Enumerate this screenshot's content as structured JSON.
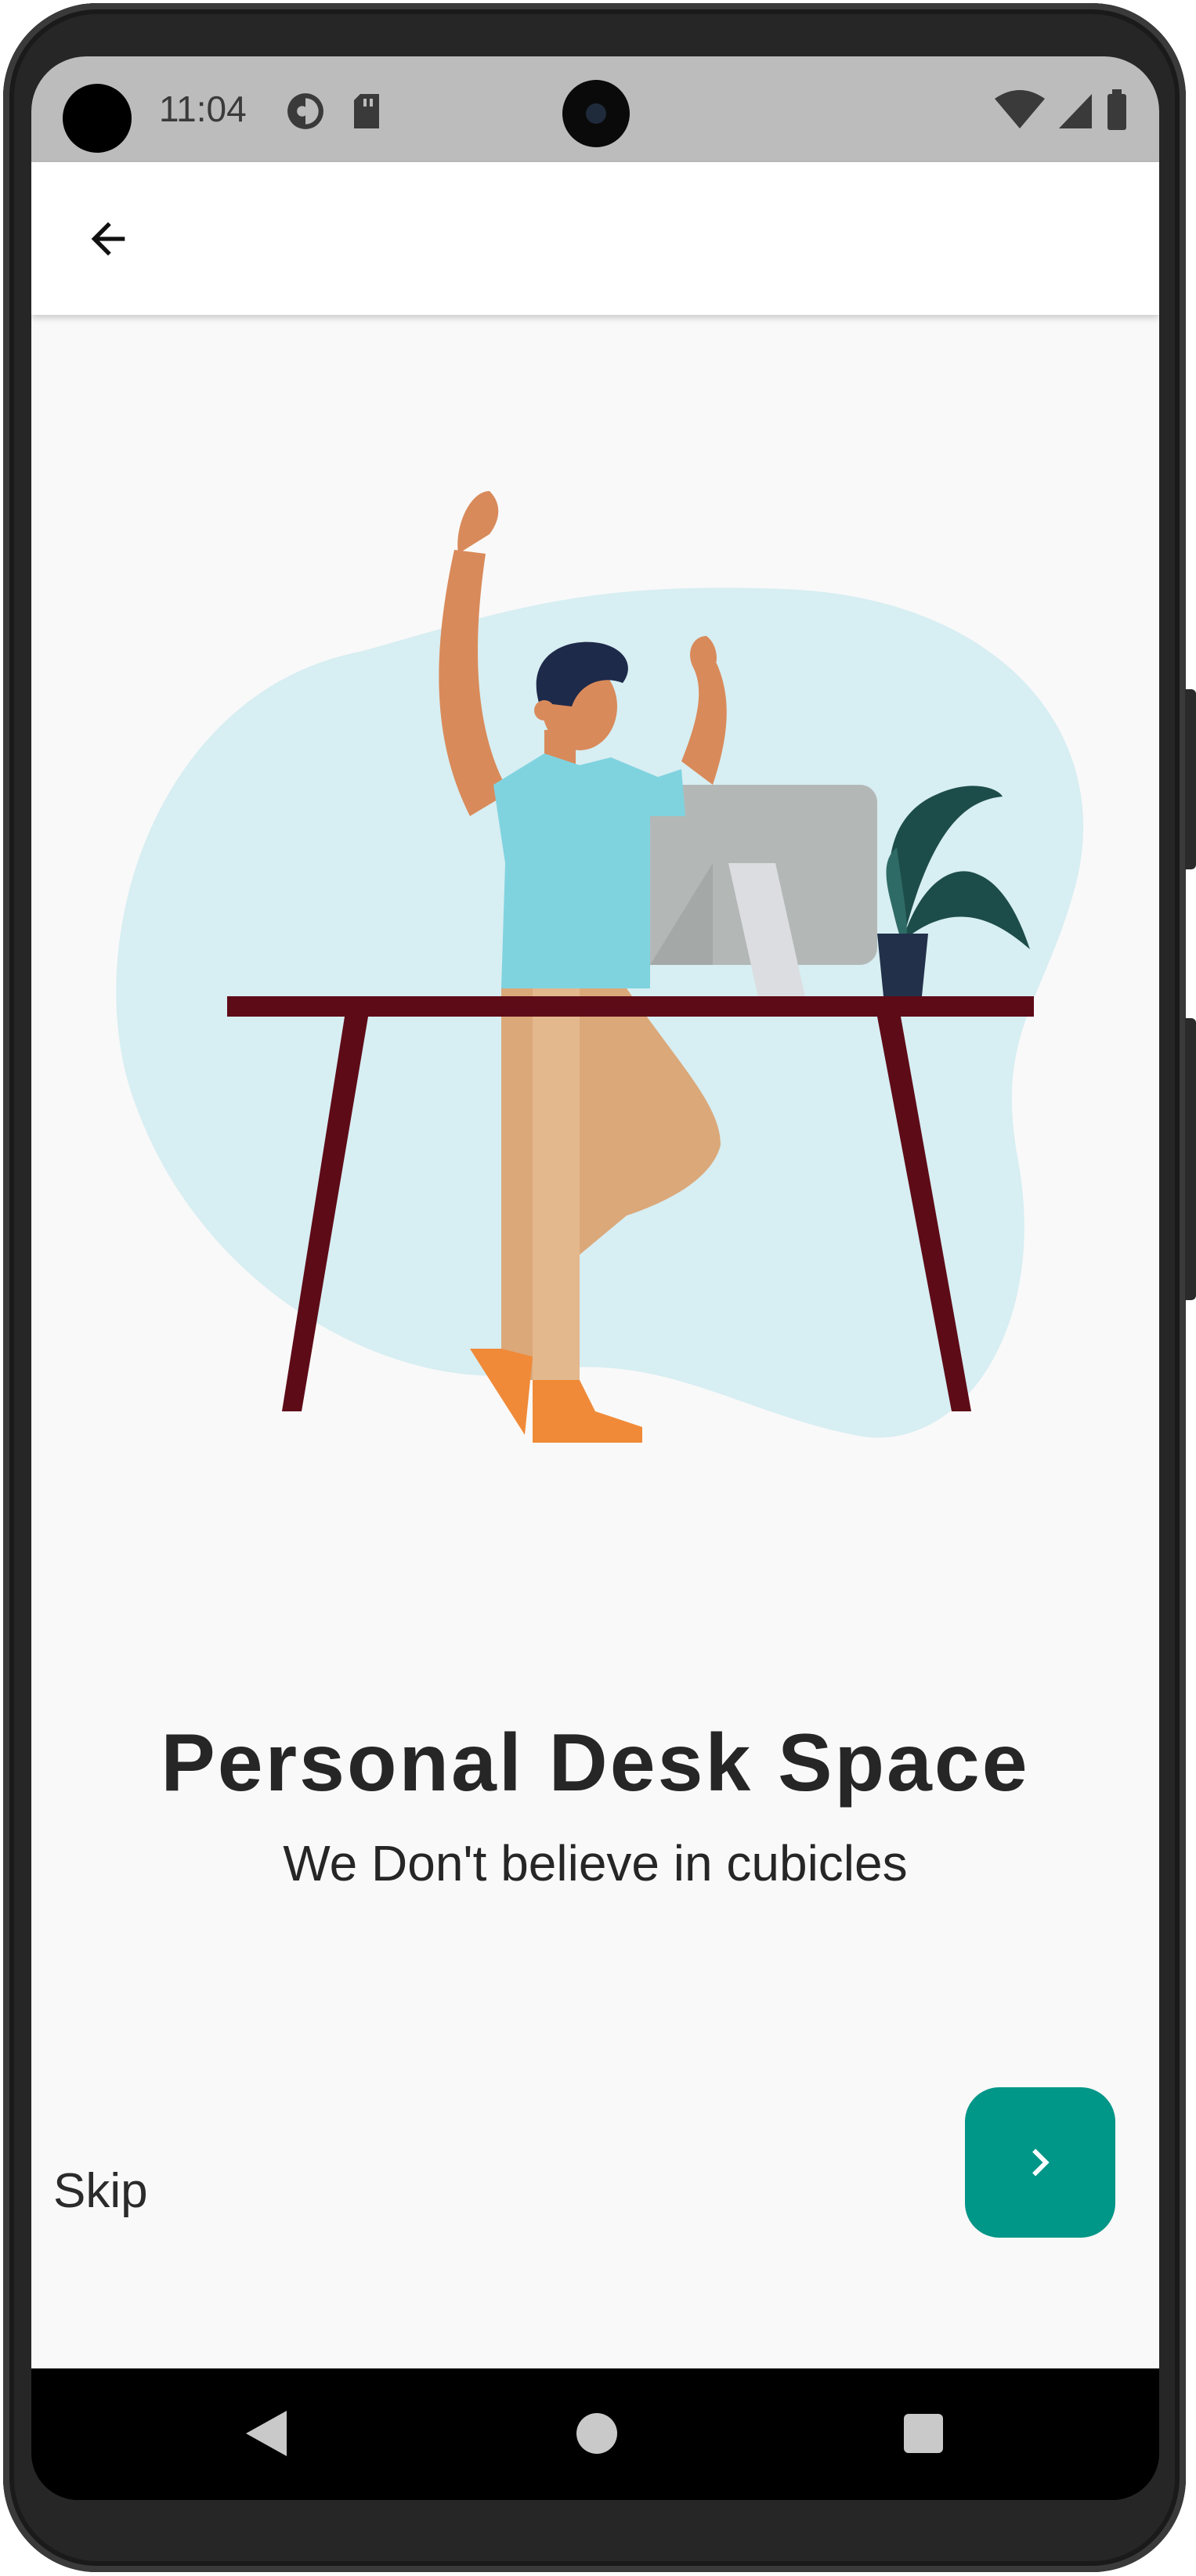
{
  "status_bar": {
    "time": "11:04",
    "icons": [
      "account-circle-icon",
      "sd-card-icon",
      "wifi-icon",
      "signal-icon",
      "battery-icon"
    ]
  },
  "app_bar": {
    "back_icon": "arrow-left-icon"
  },
  "onboarding": {
    "title": "Personal Desk Space",
    "subtitle": "We Don't believe in cubicles",
    "skip_label": "Skip",
    "next_icon": "chevron-right-icon"
  },
  "colors": {
    "accent": "#009688",
    "blob": "#d7eef2",
    "desk": "#5e0b18",
    "shirt": "#7fd3df",
    "pants": "#dba87a",
    "monitor": "#b3b8b7",
    "plant": "#1d4d4a"
  },
  "nav_bar": {
    "icons": [
      "nav-back-icon",
      "nav-home-icon",
      "nav-recents-icon"
    ]
  }
}
